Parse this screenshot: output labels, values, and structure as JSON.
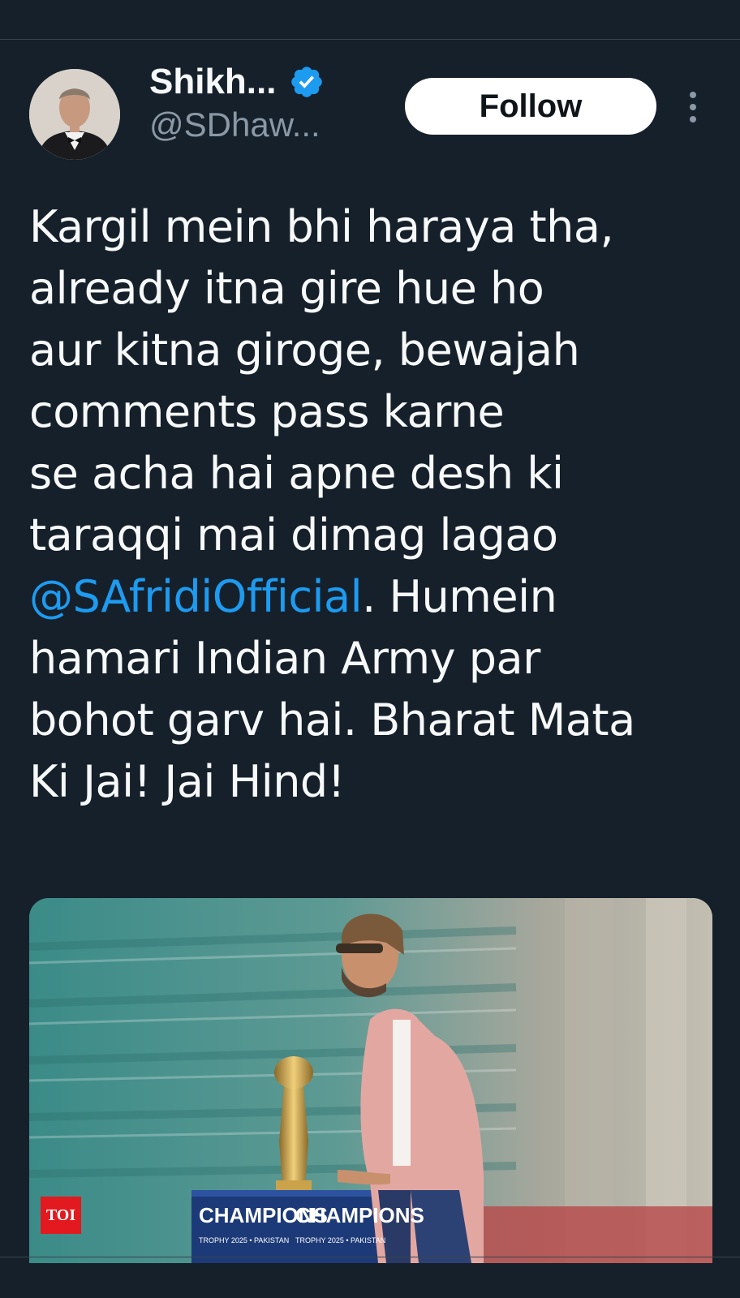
{
  "author": {
    "display_name": "Shikh...",
    "handle": "@SDhaw...",
    "verified": true,
    "avatar_icon": "profile-photo"
  },
  "actions": {
    "follow_label": "Follow",
    "more_icon": "vertical-ellipsis-icon"
  },
  "tweet": {
    "lines": [
      "Kargil mein bhi haraya tha,",
      "already itna gire hue ho",
      "aur kitna giroge, bewajah",
      "comments pass karne",
      "se acha hai apne desh ki",
      "taraqqi mai dimag lagao"
    ],
    "mention": "@SAfridiOfficial",
    "after_mention": ". Humein",
    "lines_after": [
      "hamari Indian Army par",
      "bohot garv hai. Bharat Mata",
      "Ki Jai! Jai Hind!"
    ]
  },
  "media": {
    "badge": "TOI",
    "banner_text": [
      "CHAMPIONS",
      "CHAMPIONS"
    ],
    "banner_subtext": [
      "TROPHY 2025 • PAKISTAN",
      "TROPHY 2025 • PAKISTAN"
    ]
  },
  "colors": {
    "background": "#15202b",
    "accent": "#1d9bf0",
    "text": "#f7f9f9",
    "secondary_text": "#8b98a5"
  }
}
